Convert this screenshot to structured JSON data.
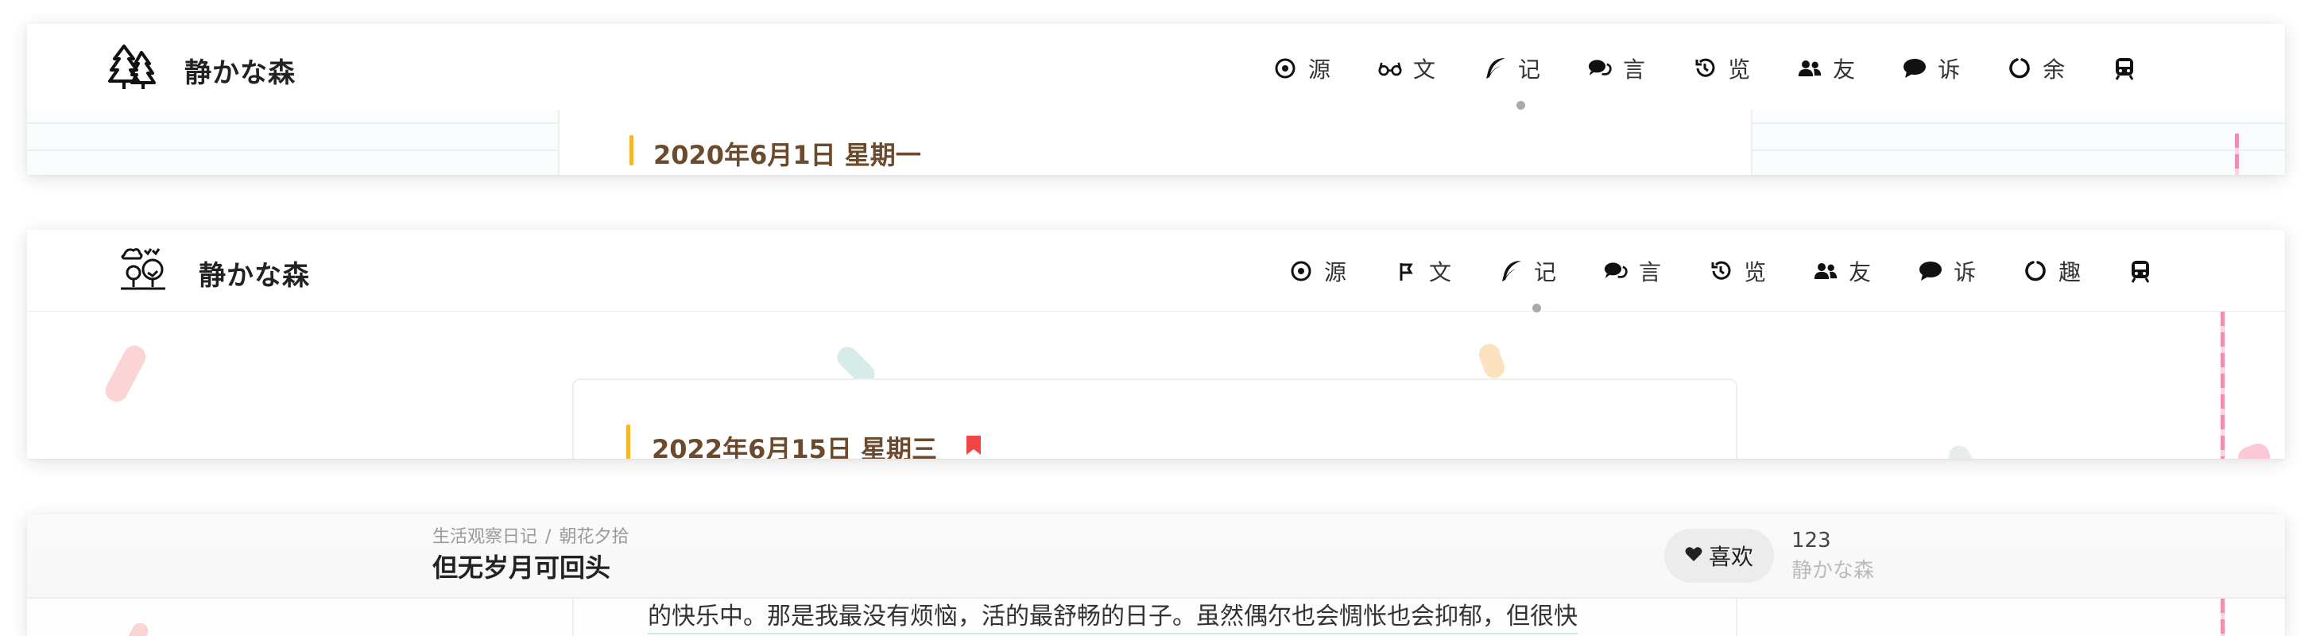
{
  "site": {
    "title": "静かな森"
  },
  "nav1": [
    {
      "label": "源",
      "icon": "target-icon",
      "active": false
    },
    {
      "label": "文",
      "icon": "glasses-icon",
      "active": false
    },
    {
      "label": "记",
      "icon": "feather-icon",
      "active": true
    },
    {
      "label": "言",
      "icon": "comments-icon",
      "active": false
    },
    {
      "label": "览",
      "icon": "history-icon",
      "active": false
    },
    {
      "label": "友",
      "icon": "users-icon",
      "active": false
    },
    {
      "label": "诉",
      "icon": "comment-icon",
      "active": false
    },
    {
      "label": "余",
      "icon": "circle-notch-icon",
      "active": false
    },
    {
      "label": "",
      "icon": "train-icon",
      "active": false
    }
  ],
  "nav2": [
    {
      "label": "源",
      "icon": "target-icon",
      "active": false
    },
    {
      "label": "文",
      "icon": "flag-icon",
      "active": false
    },
    {
      "label": "记",
      "icon": "feather-icon",
      "active": true
    },
    {
      "label": "言",
      "icon": "comments-icon",
      "active": false
    },
    {
      "label": "览",
      "icon": "history-icon",
      "active": false
    },
    {
      "label": "友",
      "icon": "users-icon",
      "active": false
    },
    {
      "label": "诉",
      "icon": "comment-icon",
      "active": false
    },
    {
      "label": "趣",
      "icon": "circle-notch-icon",
      "active": false
    },
    {
      "label": "",
      "icon": "train-icon",
      "active": false
    }
  ],
  "entry1": {
    "date": "2020年6月1日 星期一"
  },
  "entry2": {
    "date": "2022年6月15日 星期三"
  },
  "post": {
    "breadcrumb": [
      "生活观察日记",
      "朝花夕拾"
    ],
    "breadcrumb_sep": "/",
    "title": "但无岁月可回头",
    "like_label": "喜欢",
    "like_count": "123",
    "site_name": "静かな森",
    "excerpt": "的快乐中。那是我最没有烦恼，活的最舒畅的日子。虽然偶尔也会惆怅也会抑郁，但很快"
  },
  "colors": {
    "accent_bar": "#f4b72b",
    "date_text": "#6b4a2d",
    "bookmark": "#f04545",
    "pink_line": "#f28db1"
  }
}
